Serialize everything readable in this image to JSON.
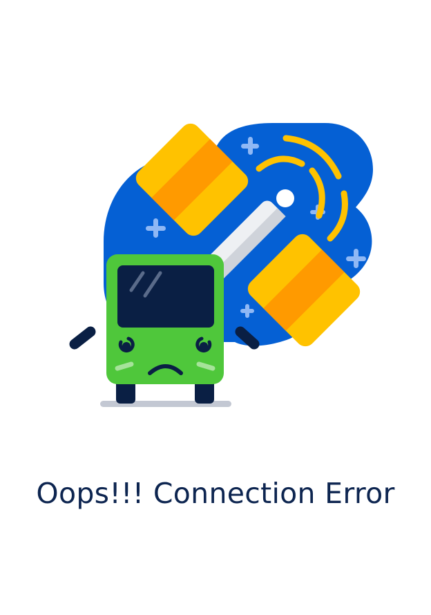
{
  "error": {
    "title": "Oops!!! Connection Error"
  },
  "illustration": {
    "icons": [
      "satellite-icon",
      "signal-waves-icon",
      "sad-bus-icon",
      "sparkle-icon"
    ]
  },
  "colors": {
    "blob_blue": "#0560d4",
    "panel_yellow": "#ffc200",
    "panel_orange": "#ff9a00",
    "bus_green": "#4fc73b",
    "bus_dark": "#0a1f44",
    "text_navy": "#0d2550"
  }
}
